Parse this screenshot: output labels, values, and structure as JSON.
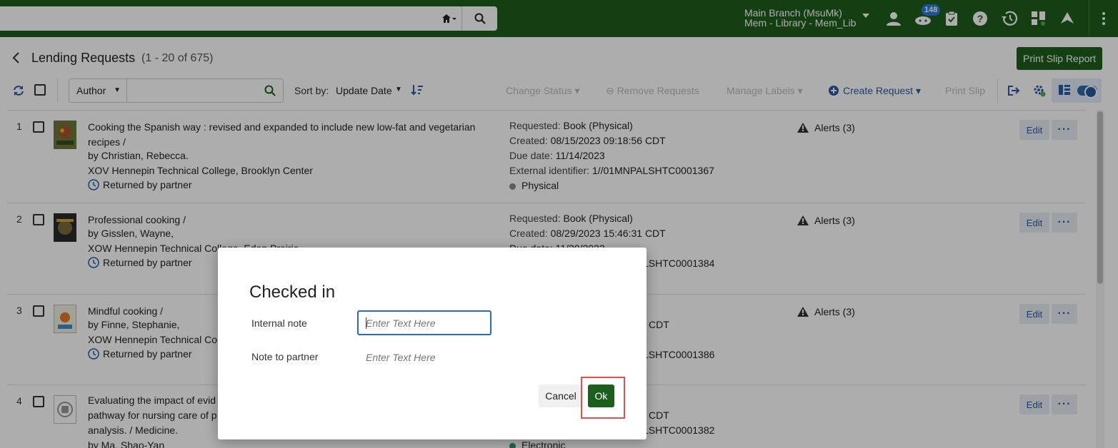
{
  "topbar": {
    "search_value": "",
    "branch_line1": "Main Branch (MsuMk)",
    "branch_line2": "Mem - Library - Mem_Lib",
    "notifications_count": "148",
    "icons": [
      "home-icon",
      "search-icon",
      "user-icon",
      "tasks-icon",
      "clipboard-icon",
      "help-icon",
      "history-icon",
      "widgets-icon",
      "plane-icon",
      "more-vert-icon"
    ]
  },
  "header": {
    "title": "Lending Requests",
    "count": "(1 - 20 of 675)",
    "print_slip_report": "Print Slip Report"
  },
  "toolbar": {
    "search_field": "Author",
    "search_value": "",
    "sort_label": "Sort by:",
    "sort_value": "Update Date",
    "change_status": "Change Status",
    "remove_requests": "Remove Requests",
    "manage_labels": "Manage Labels",
    "create_request": "Create Request",
    "print_slip": "Print Slip"
  },
  "rows": [
    {
      "num": "1",
      "title": "Cooking the Spanish way : revised and expanded to include new low-fat and vegetarian recipes /",
      "author": "by Christian, Rebecca.",
      "partner": "XOV Hennepin Technical College, Brooklyn Center",
      "status": "Returned by partner",
      "requested_k": "Requested:",
      "requested_v": "Book (Physical)",
      "created_k": "Created:",
      "created_v": "08/15/2023 09:18:56 CDT",
      "due_k": "Due date:",
      "due_v": "11/14/2023",
      "ext_k": "External identifier:",
      "ext_v": "1//01MNPALSHTC0001367",
      "format": "Physical",
      "alerts": "Alerts (3)",
      "edit": "Edit"
    },
    {
      "num": "2",
      "title": "Professional cooking /",
      "author": "by Gisslen, Wayne,",
      "partner": "XOW Hennepin Technical College, Eden Prairie",
      "status": "Returned by partner",
      "requested_k": "Requested:",
      "requested_v": "Book (Physical)",
      "created_k": "Created:",
      "created_v": "08/29/2023 15:46:31 CDT",
      "due_partial": "Due date: 11/20/2023",
      "ext_tail": "LSHTC0001384",
      "alerts": "Alerts (3)",
      "edit": "Edit"
    },
    {
      "num": "3",
      "title": "Mindful cooking /",
      "author": "by Finne, Stephanie,",
      "partner": "XOW Hennepin Technical Col",
      "status": "Returned by partner",
      "created_tail": "CDT",
      "ext_tail": "LSHTC0001386",
      "alerts": "Alerts (3)",
      "edit": "Edit"
    },
    {
      "num": "4",
      "title_l1": "Evaluating the impact of evid",
      "title_l2": "pathway for nursing care of p",
      "title_l3": "analysis. / Medicine.",
      "author": "by Ma, Shao-Yan",
      "created_tail": "CDT",
      "ext_tail": "LSHTC0001382",
      "format": "Electronic",
      "edit": "Edit"
    }
  ],
  "modal": {
    "title": "Checked in",
    "internal_note_label": "Internal note",
    "internal_note_placeholder": "Enter Text Here",
    "partner_note_label": "Note to partner",
    "partner_note_placeholder": "Enter Text Here",
    "cancel": "Cancel",
    "ok": "Ok"
  },
  "colors": {
    "brand_green": "#1c5e1c",
    "link_blue": "#2a5aa7",
    "highlight_red": "#d9534f",
    "badge_blue": "#2b7bd6"
  }
}
